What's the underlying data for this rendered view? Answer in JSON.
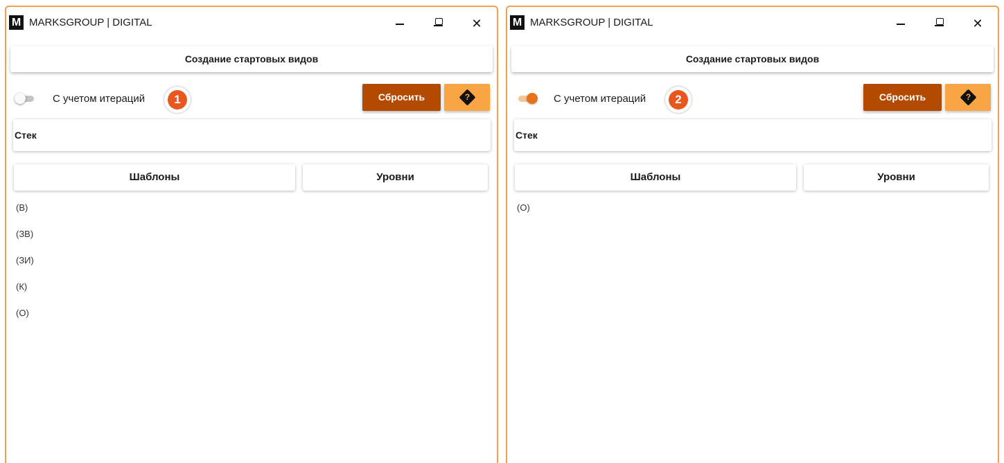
{
  "windows": [
    {
      "app_title": "MARKSGROUP | DIGITAL",
      "app_logo": "M",
      "header_label": "Создание стартовых видов",
      "toggle_label": "С учетом итераций",
      "toggle_state": "off",
      "step_number": "1",
      "reset_label": "Сбросить",
      "help_icon": "question-diamond-icon",
      "stack_label": "Стек",
      "tabs": [
        "Шаблоны",
        "Уровни"
      ],
      "items": [
        "(В)",
        "(ЗВ)",
        "(ЗИ)",
        "(К)",
        "(О)"
      ]
    },
    {
      "app_title": "MARKSGROUP | DIGITAL",
      "app_logo": "M",
      "header_label": "Создание стартовых видов",
      "toggle_label": "С учетом итераций",
      "toggle_state": "on",
      "step_number": "2",
      "reset_label": "Сбросить",
      "help_icon": "question-diamond-icon",
      "stack_label": "Стек",
      "tabs": [
        "Шаблоны",
        "Уровни"
      ],
      "items": [
        "(О)"
      ]
    }
  ],
  "colors": {
    "window_border": "#f0a050",
    "accent_orange": "#e8711b",
    "reset_button": "#b24b00",
    "help_button": "#f7a545",
    "step_badge": "#e8571e"
  }
}
